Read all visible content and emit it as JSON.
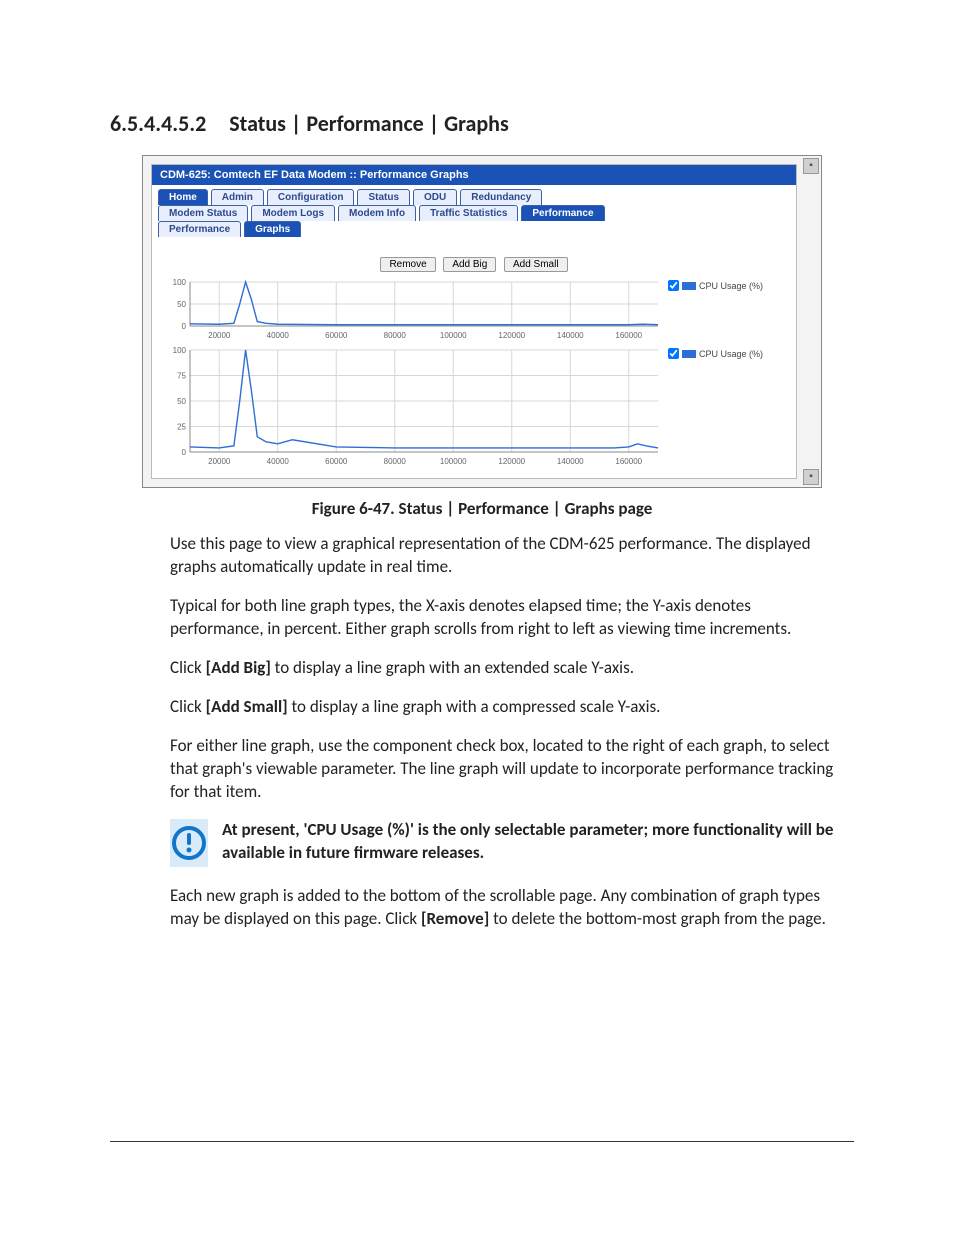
{
  "heading": {
    "number": "6.5.4.4.5.2",
    "title": "Status | Performance | Graphs"
  },
  "caption": "Figure 6-47. Status | Performance | Graphs page",
  "screenshot": {
    "title": "CDM-625: Comtech EF Data Modem :: Performance Graphs",
    "tabs_primary": [
      "Home",
      "Admin",
      "Configuration",
      "Status",
      "ODU",
      "Redundancy"
    ],
    "tabs_primary_active": 0,
    "tabs_secondary": [
      "Modem Status",
      "Modem Logs",
      "Modem Info",
      "Traffic Statistics",
      "Performance"
    ],
    "tabs_secondary_active": 4,
    "tabs_tertiary": [
      "Performance",
      "Graphs"
    ],
    "tabs_tertiary_active": 1,
    "buttons": {
      "remove": "Remove",
      "add_big": "Add Big",
      "add_small": "Add Small"
    },
    "legend_label": "CPU Usage (%)"
  },
  "body": {
    "p1": "Use this page to view a graphical representation of the CDM-625 performance. The displayed graphs automatically update in real time.",
    "p2": "Typical for both line graph types, the X-axis denotes elapsed time; the Y-axis denotes performance, in percent. Either graph scrolls from right to left as viewing time increments.",
    "p3_a": "Click ",
    "p3_b": "[Add Big]",
    "p3_c": " to display a line graph with an extended scale Y-axis.",
    "p4_a": "Click ",
    "p4_b": "[Add Small]",
    "p4_c": " to display a line graph with a compressed scale Y-axis.",
    "p5": "For either line graph, use the component check box, located to the right of each graph, to select that graph's viewable parameter. The line graph will update to incorporate performance tracking for that item.",
    "note": "At present, 'CPU Usage (%)' is the only selectable parameter; more functionality will be available in future firmware releases.",
    "p6_a": "Each new graph is added to the bottom of the scrollable page. Any combination of graph types may be displayed on this page. Click ",
    "p6_b": "[Remove]",
    "p6_c": " to delete the bottom-most graph from the page."
  },
  "chart_data": [
    {
      "type": "line",
      "title": "",
      "xlabel": "",
      "ylabel": "",
      "xlim": [
        10000,
        170000
      ],
      "ylim": [
        0,
        100
      ],
      "xticks": [
        20000,
        40000,
        60000,
        80000,
        100000,
        120000,
        140000,
        160000
      ],
      "yticks": [
        0,
        50,
        100
      ],
      "series": [
        {
          "name": "CPU Usage (%)",
          "x": [
            10000,
            20000,
            25000,
            27000,
            29000,
            31000,
            33000,
            36000,
            40000,
            60000,
            80000,
            100000,
            120000,
            140000,
            155000,
            160000,
            165000,
            170000
          ],
          "y": [
            5,
            4,
            6,
            50,
            100,
            60,
            10,
            6,
            4,
            3,
            3,
            3,
            3,
            3,
            3,
            3,
            4,
            3
          ]
        }
      ]
    },
    {
      "type": "line",
      "title": "",
      "xlabel": "",
      "ylabel": "",
      "xlim": [
        10000,
        170000
      ],
      "ylim": [
        0,
        100
      ],
      "xticks": [
        20000,
        40000,
        60000,
        80000,
        100000,
        120000,
        140000,
        160000
      ],
      "yticks": [
        0,
        25,
        50,
        75,
        100
      ],
      "series": [
        {
          "name": "CPU Usage (%)",
          "x": [
            10000,
            20000,
            25000,
            27000,
            29000,
            31000,
            33000,
            36000,
            40000,
            45000,
            60000,
            80000,
            100000,
            120000,
            140000,
            155000,
            160000,
            163000,
            166000,
            170000
          ],
          "y": [
            5,
            4,
            6,
            50,
            100,
            60,
            15,
            10,
            8,
            12,
            5,
            4,
            4,
            4,
            4,
            4,
            5,
            8,
            6,
            4
          ]
        }
      ]
    }
  ]
}
